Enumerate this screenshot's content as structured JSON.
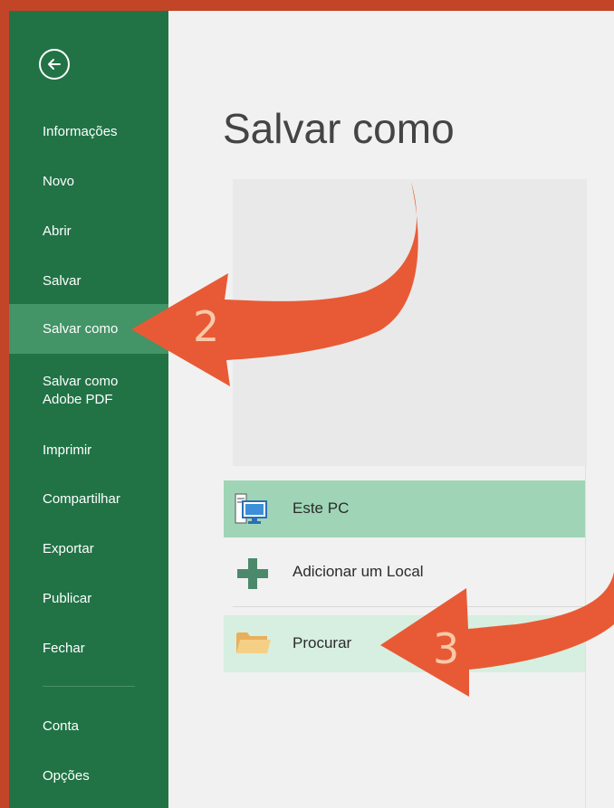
{
  "sidebar": {
    "back_icon": "back-arrow-icon",
    "items": [
      {
        "label": "Informações"
      },
      {
        "label": "Novo"
      },
      {
        "label": "Abrir"
      },
      {
        "label": "Salvar"
      },
      {
        "label": "Salvar como",
        "active": true
      },
      {
        "label": "Salvar como\nAdobe PDF"
      },
      {
        "label": "Imprimir"
      },
      {
        "label": "Compartilhar"
      },
      {
        "label": "Exportar"
      },
      {
        "label": "Publicar"
      },
      {
        "label": "Fechar"
      },
      {
        "label": "Conta"
      },
      {
        "label": "Opções"
      }
    ]
  },
  "main": {
    "title": "Salvar como",
    "locations": [
      {
        "label": "Este PC",
        "icon": "computer-icon",
        "state": "selected"
      },
      {
        "label": "Adicionar um Local",
        "icon": "plus-icon"
      },
      {
        "label": "Procurar",
        "icon": "folder-icon",
        "state": "hover"
      }
    ]
  },
  "annotations": {
    "step2": "2",
    "step3": "3"
  },
  "colors": {
    "frame_border": "#c24528",
    "sidebar_bg": "#217346",
    "sidebar_active": "#439467",
    "selected_location": "#9fd5b6",
    "hover_location": "#d6efe0",
    "arrow": "#e85a35"
  }
}
